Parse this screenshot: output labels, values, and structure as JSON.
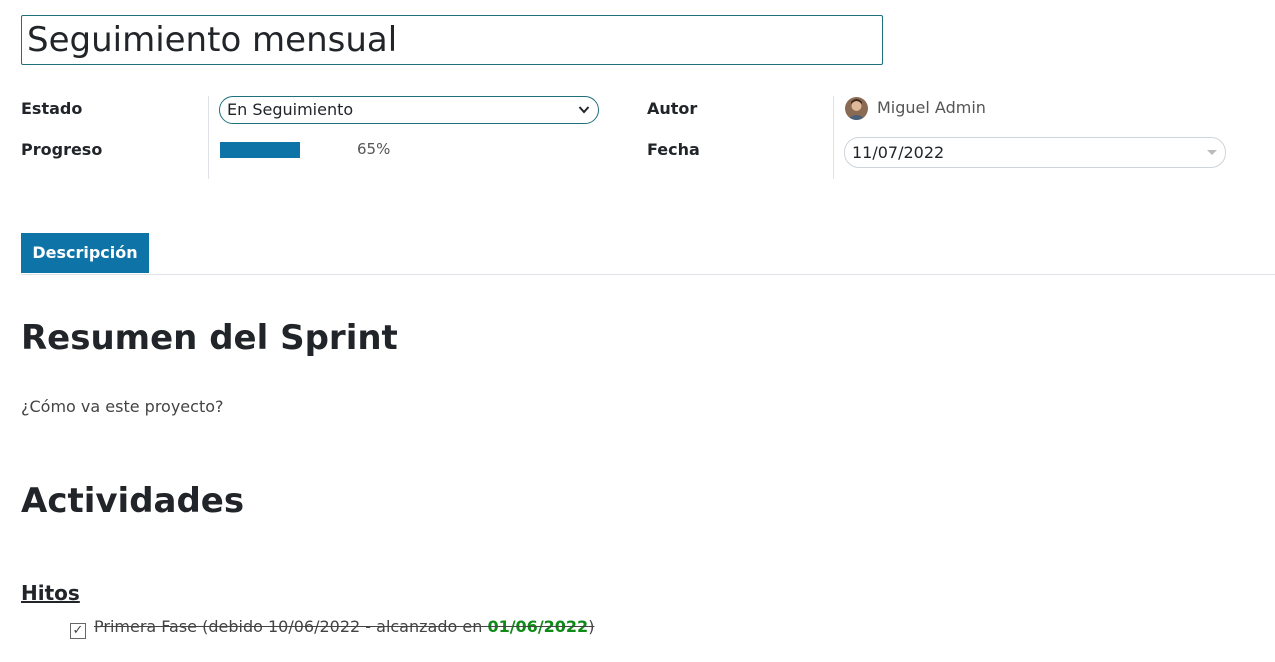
{
  "title": "Seguimiento mensual",
  "fields": {
    "estado_label": "Estado",
    "estado_value": "En Seguimiento",
    "progreso_label": "Progreso",
    "progreso_value": 65,
    "progreso_text": "65%",
    "autor_label": "Autor",
    "autor_value": "Miguel Admin",
    "fecha_label": "Fecha",
    "fecha_value": "11/07/2022"
  },
  "tabs": [
    {
      "label": "Descripción"
    }
  ],
  "content": {
    "heading1": "Resumen del Sprint",
    "question": "¿Cómo va este proyecto?",
    "heading2": "Actividades",
    "subheading": "Hitos",
    "milestone": {
      "prefix": "Primera Fase (debido 10/06/2022 - alcanzado en ",
      "reached_date": "01/06/2022",
      "suffix": ")",
      "check_glyph": "✓"
    }
  },
  "colors": {
    "accent": "#0e74a7",
    "border_teal": "#1f6f7c",
    "success": "#0e8a16"
  },
  "icons": {
    "select_arrow": "chevron-down-icon",
    "date_caret": "caret-down-icon",
    "avatar": "user-avatar"
  }
}
